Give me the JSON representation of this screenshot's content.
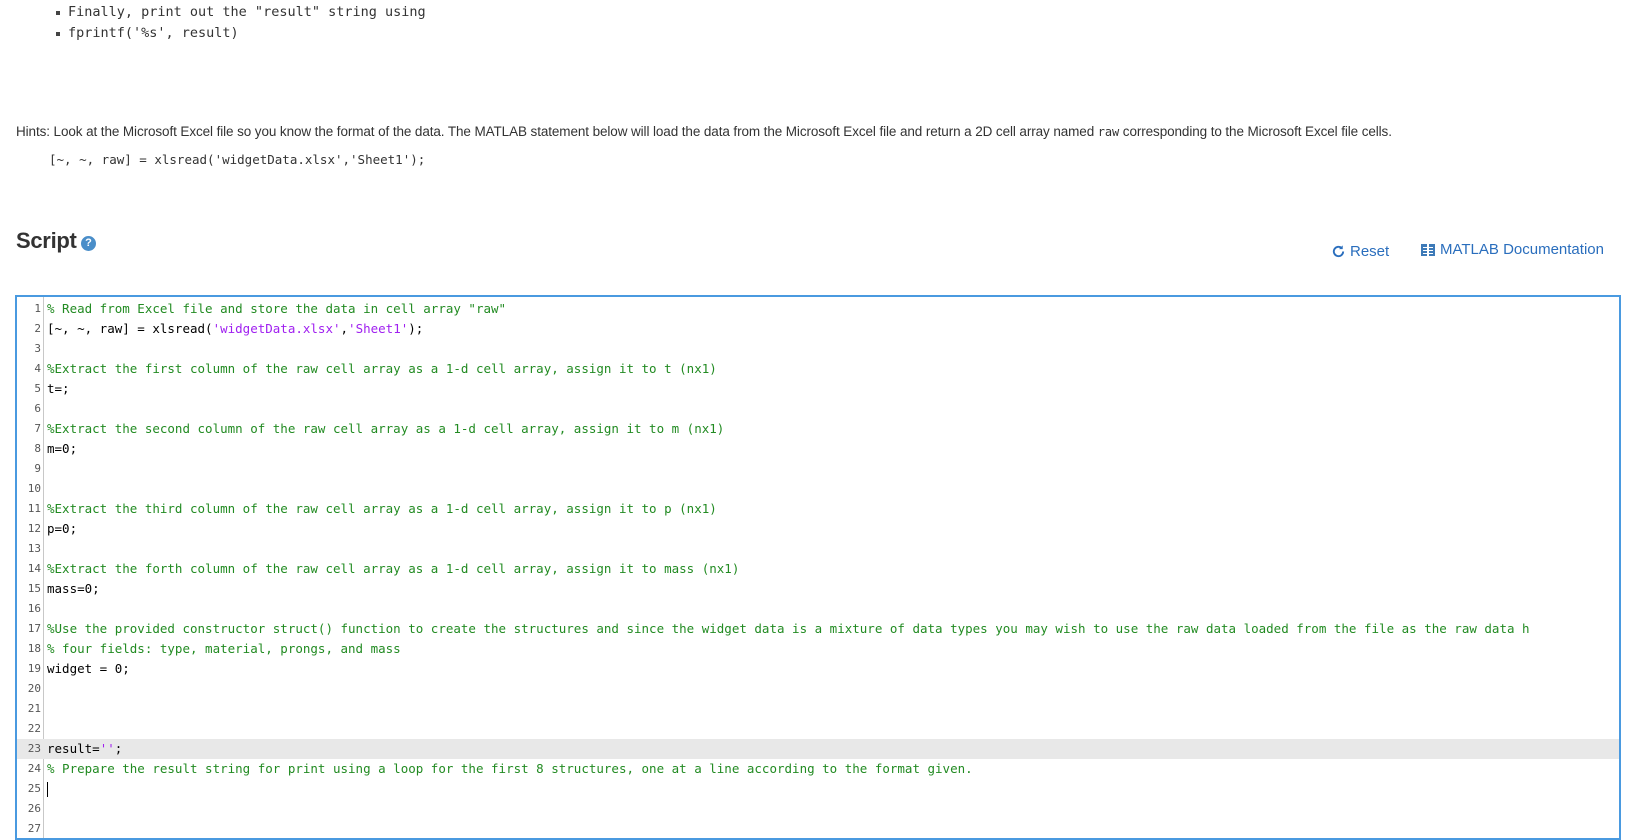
{
  "instructions": {
    "bullets": [
      "Finally, print out the \"result\" string using",
      "fprintf('%s', result)"
    ],
    "hint_text_before": "Hints: Look at the Microsoft Excel file so you know the format of the data. The MATLAB statement below will load the data from the Microsoft Excel file and return a 2D cell array named ",
    "hint_code_word": "raw",
    "hint_text_after": " corresponding to the Microsoft Excel file cells.",
    "hint_code_line": "[~, ~, raw] = xlsread('widgetData.xlsx','Sheet1');"
  },
  "script": {
    "title": "Script",
    "help_icon": "?",
    "reset_label": "Reset",
    "doc_label": "MATLAB Documentation"
  },
  "editor": {
    "active_line": 23,
    "lines": [
      {
        "n": "1",
        "parts": [
          {
            "t": "% Read from Excel file and store the data in cell array \"raw\"",
            "c": "cmt"
          }
        ]
      },
      {
        "n": "2",
        "parts": [
          {
            "t": "[~, ~, raw] = xlsread(",
            "c": ""
          },
          {
            "t": "'widgetData.xlsx'",
            "c": "str"
          },
          {
            "t": ",",
            "c": ""
          },
          {
            "t": "'Sheet1'",
            "c": "str"
          },
          {
            "t": ");",
            "c": ""
          }
        ]
      },
      {
        "n": "3",
        "parts": []
      },
      {
        "n": "4",
        "parts": [
          {
            "t": "%Extract the first column of the raw cell array as a 1-d cell array, assign it to t (nx1)",
            "c": "cmt"
          }
        ]
      },
      {
        "n": "5",
        "parts": [
          {
            "t": "t=;",
            "c": ""
          }
        ]
      },
      {
        "n": "6",
        "parts": []
      },
      {
        "n": "7",
        "parts": [
          {
            "t": "%Extract the second column of the raw cell array as a 1-d cell array, assign it to m (nx1)",
            "c": "cmt"
          }
        ]
      },
      {
        "n": "8",
        "parts": [
          {
            "t": "m=0;",
            "c": ""
          }
        ]
      },
      {
        "n": "9",
        "parts": []
      },
      {
        "n": "10",
        "parts": []
      },
      {
        "n": "11",
        "parts": [
          {
            "t": "%Extract the third column of the raw cell array as a 1-d cell array, assign it to p (nx1)",
            "c": "cmt"
          }
        ]
      },
      {
        "n": "12",
        "parts": [
          {
            "t": "p=0;",
            "c": ""
          }
        ]
      },
      {
        "n": "13",
        "parts": []
      },
      {
        "n": "14",
        "parts": [
          {
            "t": "%Extract the forth column of the raw cell array as a 1-d cell array, assign it to mass (nx1)",
            "c": "cmt"
          }
        ]
      },
      {
        "n": "15",
        "parts": [
          {
            "t": "mass=0;",
            "c": ""
          }
        ]
      },
      {
        "n": "16",
        "parts": []
      },
      {
        "n": "17",
        "parts": [
          {
            "t": "%Use the provided constructor struct() function to create the structures and since the widget data is a mixture of data types you may wish to use the raw data loaded from the file as the raw data h",
            "c": "cmt"
          }
        ]
      },
      {
        "n": "18",
        "parts": [
          {
            "t": "% four fields: type, material, prongs, and mass",
            "c": "cmt"
          }
        ]
      },
      {
        "n": "19",
        "parts": [
          {
            "t": "widget = 0;",
            "c": ""
          }
        ]
      },
      {
        "n": "20",
        "parts": []
      },
      {
        "n": "21",
        "parts": []
      },
      {
        "n": "22",
        "parts": []
      },
      {
        "n": "23",
        "parts": [
          {
            "t": "result=",
            "c": ""
          },
          {
            "t": "''",
            "c": "str"
          },
          {
            "t": ";",
            "c": ""
          }
        ]
      },
      {
        "n": "24",
        "parts": [
          {
            "t": "% Prepare the result string for print using a loop for the first 8 structures, one at a line according to the format given.",
            "c": "cmt"
          }
        ]
      },
      {
        "n": "25",
        "parts": [],
        "cursor": true
      },
      {
        "n": "26",
        "parts": []
      },
      {
        "n": "27",
        "parts": []
      }
    ]
  }
}
